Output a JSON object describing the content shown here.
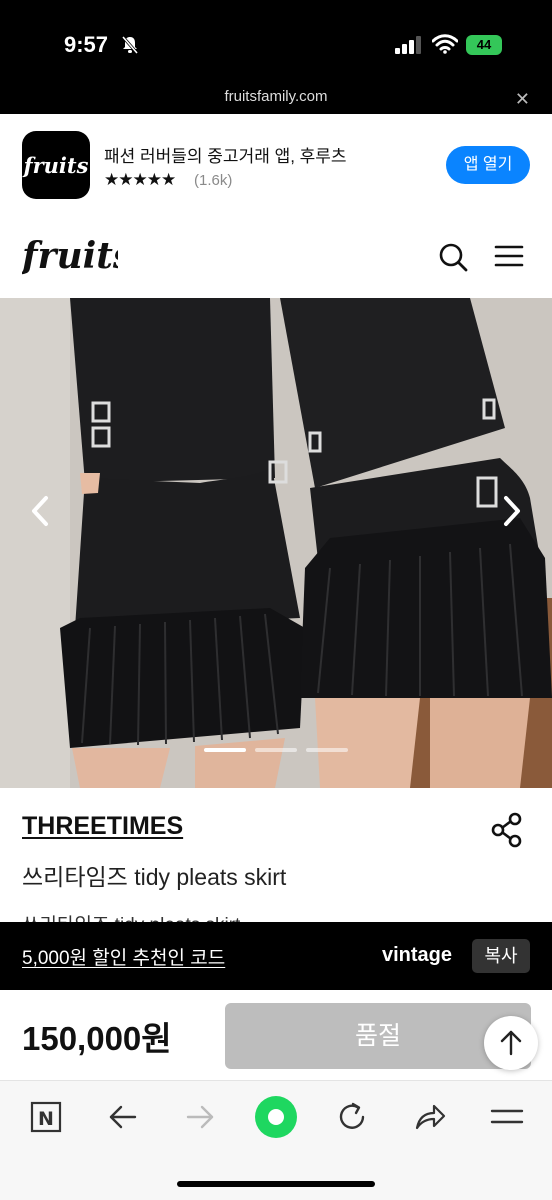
{
  "status_bar": {
    "time": "9:57",
    "battery": "44"
  },
  "browser": {
    "domain": "fruitsfamily.com"
  },
  "app_banner": {
    "title": "패션 러버들의 중고거래 앱, 후루츠",
    "stars": "★★★★★",
    "rating": "(1.6k)",
    "open_label": "앱 열기"
  },
  "header": {
    "logo": "fruits"
  },
  "product": {
    "brand": "THREETIMES",
    "title": "쓰리타임즈 tidy pleats skirt",
    "description": "쓰리타임즈 tidy pleats skirt",
    "price": "150,000원",
    "sold_out_label": "품절",
    "slide_count": 3,
    "active_slide": 1
  },
  "promo": {
    "text": "5,000원 할인 추천인 코드",
    "code": "vintage",
    "copy_label": "복사"
  },
  "colors": {
    "accent_blue": "#0a84ff",
    "browser_green": "#1ed760",
    "sold_out_gray": "#bdbdbd"
  },
  "icons": [
    "silent-bell-icon",
    "signal-icon",
    "wifi-icon",
    "close-icon",
    "search-icon",
    "menu-icon",
    "chevron-left-icon",
    "chevron-right-icon",
    "share-icon",
    "arrow-up-icon",
    "naver-n-icon",
    "back-icon",
    "forward-icon",
    "green-home-icon",
    "refresh-icon",
    "share-arrow-icon",
    "tab-menu-icon"
  ]
}
